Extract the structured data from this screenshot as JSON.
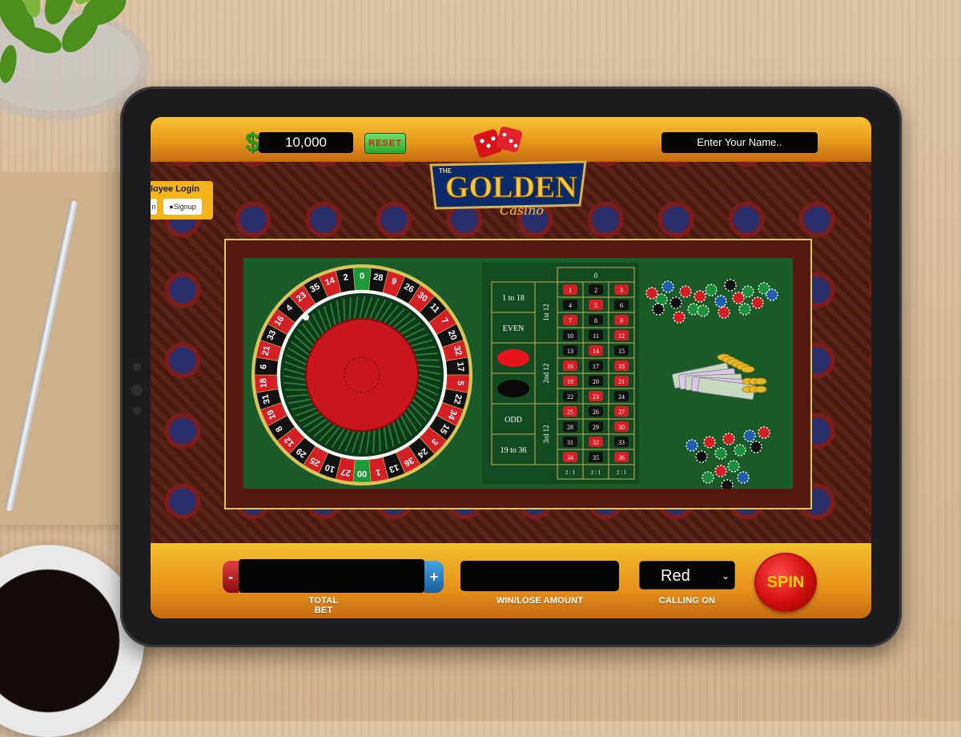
{
  "header": {
    "currency_symbol": "$",
    "balance": "10,000",
    "reset_label": "RESET",
    "name_placeholder": "Enter Your Name.."
  },
  "logo": {
    "small": "THE",
    "main": "GOLDEN",
    "script": "Casino"
  },
  "login": {
    "title": "loyee Login",
    "login_btn": "n",
    "signup_btn": "Signup"
  },
  "wheel": {
    "numbers": [
      "0",
      "28",
      "9",
      "26",
      "30",
      "11",
      "7",
      "20",
      "32",
      "17",
      "5",
      "22",
      "34",
      "15",
      "3",
      "24",
      "36",
      "13",
      "1",
      "00",
      "27",
      "10",
      "25",
      "29",
      "12",
      "8",
      "19",
      "31",
      "18",
      "6",
      "21",
      "33",
      "16",
      "4",
      "23",
      "35",
      "14",
      "2"
    ],
    "colors": {
      "red": "#d41f25",
      "black": "#111111",
      "green": "#1c9a3a"
    }
  },
  "board": {
    "zero": "0",
    "outside": [
      "1 to 18",
      "EVEN",
      "",
      "",
      "ODD",
      "19 to 36"
    ],
    "dozens": [
      "1st 12",
      "2nd 12",
      "3rd 12"
    ],
    "rows": [
      [
        "1",
        "2",
        "3"
      ],
      [
        "4",
        "5",
        "6"
      ],
      [
        "7",
        "8",
        "9"
      ],
      [
        "10",
        "11",
        "12"
      ],
      [
        "13",
        "14",
        "15"
      ],
      [
        "16",
        "17",
        "18"
      ],
      [
        "19",
        "20",
        "21"
      ],
      [
        "22",
        "23",
        "24"
      ],
      [
        "25",
        "26",
        "27"
      ],
      [
        "28",
        "29",
        "30"
      ],
      [
        "31",
        "32",
        "33"
      ],
      [
        "34",
        "35",
        "36"
      ]
    ],
    "red_numbers": [
      "1",
      "3",
      "5",
      "7",
      "9",
      "12",
      "14",
      "16",
      "18",
      "19",
      "21",
      "23",
      "25",
      "27",
      "30",
      "32",
      "34",
      "36"
    ],
    "columns": [
      "2 : 1",
      "2 : 1",
      "2 : 1"
    ]
  },
  "controls": {
    "minus": "-",
    "plus": "+",
    "total_bet_label": "TOTAL BET",
    "winlose_label": "WIN/LOSE AMOUNT",
    "calling_selected": "Red",
    "calling_label": "CALLING ON",
    "spin_label": "SPIN"
  }
}
